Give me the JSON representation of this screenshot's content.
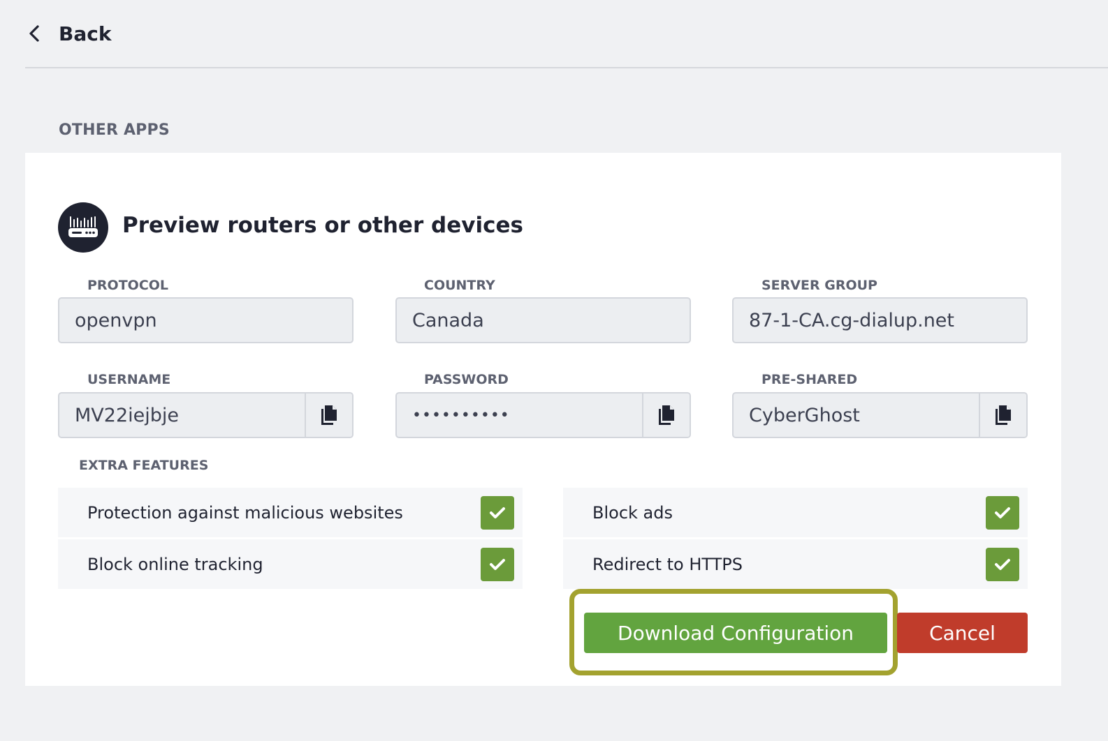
{
  "nav": {
    "back_label": "Back"
  },
  "section": {
    "title": "OTHER APPS"
  },
  "card": {
    "heading": "Preview routers or other devices",
    "icon": "router-icon"
  },
  "fields": {
    "protocol": {
      "label": "PROTOCOL",
      "value": "openvpn"
    },
    "country": {
      "label": "COUNTRY",
      "value": "Canada"
    },
    "server_group": {
      "label": "SERVER GROUP",
      "value": "87-1-CA.cg-dialup.net"
    },
    "username": {
      "label": "USERNAME",
      "value": "MV22iejbje",
      "copy_icon": "copy-icon"
    },
    "password": {
      "label": "PASSWORD",
      "value": "••••••••••",
      "copy_icon": "copy-icon"
    },
    "preshared": {
      "label": "PRE-SHARED",
      "value": "CyberGhost",
      "copy_icon": "copy-icon"
    }
  },
  "extra_features": {
    "label": "EXTRA FEATURES",
    "items": [
      {
        "label": "Protection against malicious websites",
        "checked": true
      },
      {
        "label": "Block ads",
        "checked": true
      },
      {
        "label": "Block online tracking",
        "checked": true
      },
      {
        "label": "Redirect to HTTPS",
        "checked": true
      }
    ]
  },
  "actions": {
    "download_label": "Download Configuration",
    "cancel_label": "Cancel"
  },
  "colors": {
    "accent_green": "#62a43f",
    "checkbox_green": "#6b9b3a",
    "cancel_red": "#c03c2b",
    "highlight": "#a3a22f",
    "dark": "#1f2230"
  }
}
